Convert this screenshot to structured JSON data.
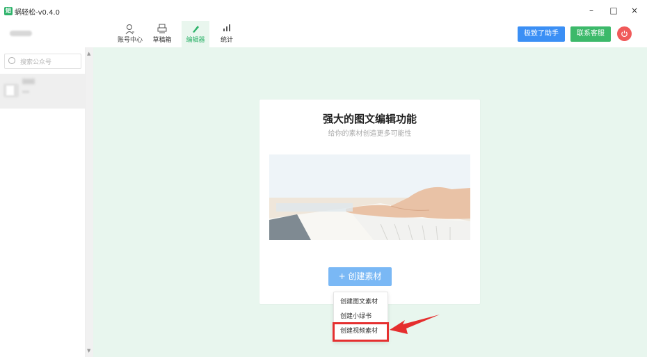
{
  "window": {
    "logo_text": "短",
    "title": "蜗轻松-v0.4.0",
    "controls": {
      "minimize": "–",
      "maximize": "□",
      "close": "×"
    }
  },
  "nav": {
    "tabs": [
      {
        "label": "账号中心",
        "icon": "user-icon"
      },
      {
        "label": "草稿箱",
        "icon": "printer-icon"
      },
      {
        "label": "编辑器",
        "icon": "pen-icon",
        "active": true
      },
      {
        "label": "统计",
        "icon": "bar-chart-icon"
      }
    ],
    "assistant_button": "极致了助手",
    "support_button": "联系客服",
    "power_icon": "power-icon"
  },
  "sidebar": {
    "search_placeholder": "搜索公众号"
  },
  "card": {
    "title": "强大的图文编辑功能",
    "subtitle": "给你的素材创造更多可能性",
    "create_button": "+ 创建素材"
  },
  "dropdown": {
    "items": [
      "创建图文素材",
      "创建小绿书",
      "创建视频素材"
    ]
  },
  "colors": {
    "brand_green": "#2fb36b",
    "blue": "#3b8ff5",
    "main_bg": "#e8f6ee",
    "highlight_red": "#e53030"
  }
}
